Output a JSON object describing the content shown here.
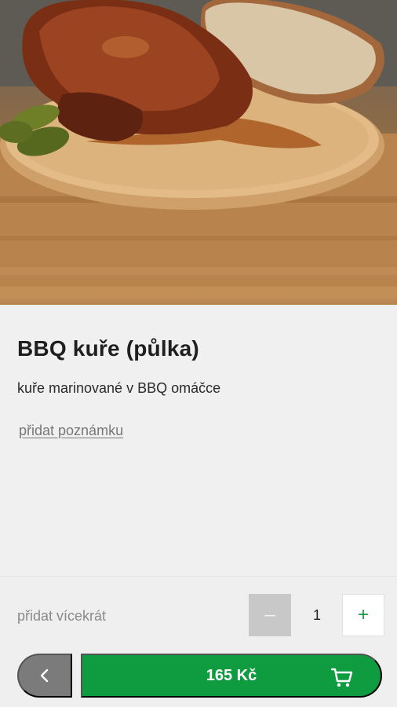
{
  "product": {
    "image_alt": "BBQ kuře",
    "title": "BBQ kuře (půlka)",
    "description": "kuře marinované v BBQ omáčce",
    "add_note_label": "přidat poznámku"
  },
  "quantity": {
    "label": "přidat vícekrát",
    "value": "1",
    "minus_symbol": "–",
    "plus_symbol": "+"
  },
  "actions": {
    "back_icon": "chevron-left-icon",
    "price": "165 Kč",
    "cart_icon": "cart-icon"
  },
  "colors": {
    "primary_green": "#0f9b3f",
    "back_gray": "#7b7b7b",
    "disabled_gray": "#c8c8c8"
  }
}
